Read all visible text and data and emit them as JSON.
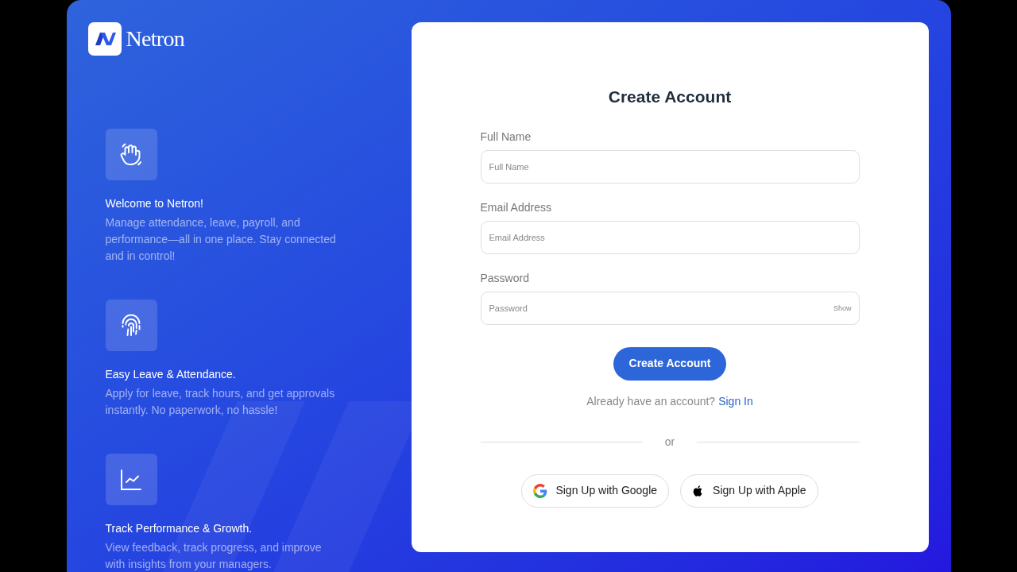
{
  "brand": {
    "name": "Netron"
  },
  "features": [
    {
      "kind": "wave",
      "title": "Welcome to Netron!",
      "text": "Manage attendance, leave, payroll, and performance—all in one place. Stay connected and in control!"
    },
    {
      "kind": "fingerprint",
      "title": "Easy Leave & Attendance.",
      "text": "Apply for leave, track hours, and get approvals instantly. No paperwork, no hassle!"
    },
    {
      "kind": "chart",
      "title": "Track Performance & Growth.",
      "text": "View feedback, track progress, and improve with insights from your managers."
    }
  ],
  "form": {
    "title": "Create Account",
    "fields": [
      {
        "label": "Full Name",
        "placeholder": "Full Name"
      },
      {
        "label": "Email Address",
        "placeholder": "Email Address"
      },
      {
        "label": "Password",
        "placeholder": "Password",
        "toggle": "Show"
      }
    ],
    "submit": "Create Account",
    "signin_prompt": "Already have an account?",
    "signin_link": "Sign In",
    "divider": "or",
    "social": [
      {
        "kind": "google",
        "label": "Sign Up with Google"
      },
      {
        "kind": "apple",
        "label": "Sign Up with Apple"
      }
    ]
  }
}
